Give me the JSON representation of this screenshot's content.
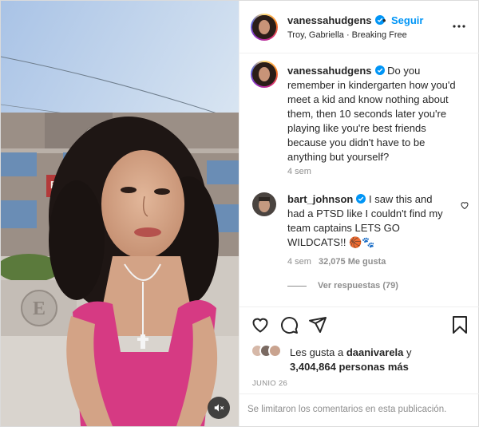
{
  "post": {
    "author": {
      "username": "vanessahudgens",
      "verified_icon": "verified-badge-icon",
      "follow_label": "Seguir",
      "separator": "•",
      "location": "Troy, Gabriella · Breaking Free"
    },
    "caption": {
      "username": "vanessahudgens",
      "text": "Do you remember in kindergarten how you'd meet a kid and know nothing about them, then 10 seconds later you're playing like you're best friends because you didn't have to be anything but yourself?",
      "age": "4 sem"
    },
    "top_comment": {
      "username": "bart_johnson",
      "text": "I saw this and had a PTSD like I couldn't find my team captains LETS GO WILDCATS!! 🏀🐾",
      "age": "4 sem",
      "likes": "32,075 Me gusta",
      "replies_label": "Ver respuestas (79)"
    },
    "likes": {
      "prefix": "Les gusta a",
      "liker": "daanivarela",
      "conjunction": "y",
      "others": "3,404,864 personas más"
    },
    "date": "JUNIO 26",
    "comments_limited": "Se limitaron los comentarios en esta publicación.",
    "icons": {
      "like": "heart-icon",
      "comment": "comment-icon",
      "share": "share-icon",
      "save": "bookmark-icon",
      "more": "more-options-icon",
      "mute": "muted-speaker-icon"
    },
    "colors": {
      "accent": "#0095f6",
      "text": "#262626",
      "muted": "#8e8e8e",
      "border": "#efefef"
    }
  }
}
